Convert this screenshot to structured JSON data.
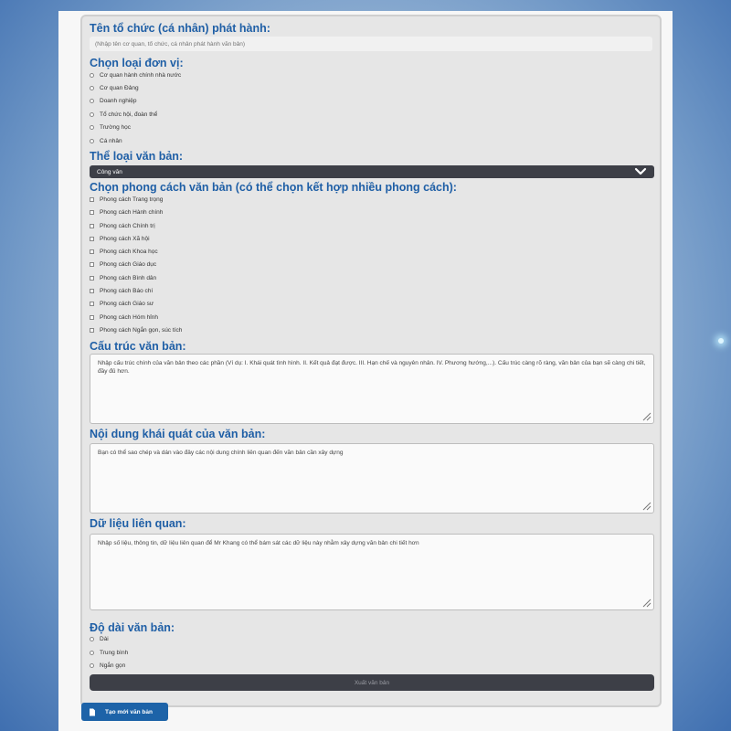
{
  "form": {
    "issuer_label": "Tên tổ chức (cá nhân) phát hành:",
    "issuer_placeholder": "(Nhập tên cơ quan, tổ chức, cá nhân phát hành văn bản)",
    "unit_label": "Chọn loại đơn vị:",
    "units": [
      "Cơ quan hành chính nhà nước",
      "Cơ quan Đảng",
      "Doanh nghiệp",
      "Tổ chức hội, đoàn thể",
      "Trường học",
      "Cá nhân"
    ],
    "doctype_label": "Thể loại văn bản:",
    "doctype_selected": "Công văn",
    "style_label": "Chọn phong cách văn bản (có thể chọn kết hợp nhiều phong cách):",
    "styles": [
      "Phong cách Trang trọng",
      "Phong cách Hành chính",
      "Phong cách Chính trị",
      "Phong cách Xã hội",
      "Phong cách Khoa học",
      "Phong cách Giáo dục",
      "Phong cách Bình dân",
      "Phong cách Báo chí",
      "Phong cách Giáo sư",
      "Phong cách Hóm hỉnh",
      "Phong cách Ngắn gọn, súc tích"
    ],
    "structure_label": "Cấu trúc văn bản:",
    "structure_placeholder": "Nhập cấu trúc chính của văn bản theo các phần (Ví dụ: I. Khái quát tình hình. II. Kết quả đạt được. III. Hạn chế và nguyên nhân. IV. Phương hướng,...). Cấu trúc càng rõ ràng, văn bản của bạn sẽ càng chi tiết, đầy đủ hơn.",
    "content_label": "Nội dung khái quát của văn bản:",
    "content_placeholder": "Bạn có thể sao chép và dán vào đây các nội dung chính liên quan đến văn bản cần xây dựng",
    "data_label": "Dữ liệu liên quan:",
    "data_placeholder": "Nhập số liệu, thông tin, dữ liệu liên quan để Mr Khang có thể bám sát các dữ liệu này nhằm xây dựng văn bản chi tiết hơn",
    "length_label": "Độ dài văn bản:",
    "lengths": [
      "Dài",
      "Trung bình",
      "Ngắn gọn"
    ],
    "submit_label": "Xuất văn bản"
  },
  "new_button_label": "Tạo mới văn bản",
  "colors": {
    "label": "#1f5fa6",
    "dark_control": "#3d3f47",
    "primary_button": "#1d63a8"
  }
}
